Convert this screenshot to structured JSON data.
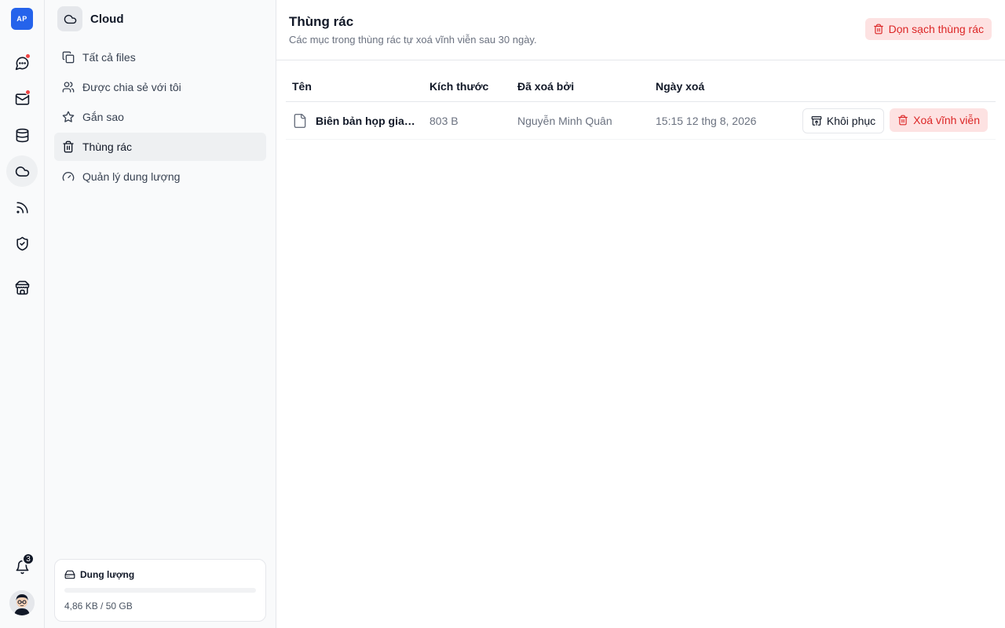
{
  "rail": {
    "logo_text": "AP",
    "notification_count": "3",
    "items": [
      {
        "name": "chat-icon",
        "badge": true
      },
      {
        "name": "mail-icon",
        "badge": true
      },
      {
        "name": "database-icon",
        "badge": false
      },
      {
        "name": "cloud-icon",
        "badge": false,
        "active": true
      },
      {
        "name": "rss-icon",
        "badge": false
      },
      {
        "name": "shield-check-icon",
        "badge": false
      },
      {
        "name": "store-icon",
        "badge": false
      }
    ]
  },
  "sidebar": {
    "title": "Cloud",
    "items": [
      {
        "label": "Tất cả files",
        "icon": "files-icon"
      },
      {
        "label": "Được chia sẻ với tôi",
        "icon": "users-icon"
      },
      {
        "label": "Gắn sao",
        "icon": "star-icon"
      },
      {
        "label": "Thùng rác",
        "icon": "trash-icon",
        "active": true
      },
      {
        "label": "Quản lý dung lượng",
        "icon": "gauge-icon"
      }
    ],
    "storage": {
      "label": "Dung lượng",
      "usage_text": "4,86 KB / 50 GB",
      "used_fraction": 1e-07
    }
  },
  "header": {
    "title": "Thùng rác",
    "subtitle": "Các mục trong thùng rác tự xoá vĩnh viễn sau 30 ngày.",
    "empty_button": "Dọn sạch thùng rác"
  },
  "table": {
    "columns": {
      "name": "Tên",
      "size": "Kích thước",
      "deleted_by": "Đã xoá bởi",
      "deleted_at": "Ngày xoá"
    },
    "rows": [
      {
        "name": "Biên bản họp giao ban",
        "size": "803 B",
        "deleted_by": "Nguyễn Minh Quân",
        "deleted_at": "15:15 12 thg 8, 2026",
        "restore_label": "Khôi phục",
        "delete_label": "Xoá vĩnh viễn"
      }
    ]
  },
  "colors": {
    "brand": "#2563eb",
    "danger": "#dc2626",
    "danger_bg": "#fde2e2",
    "badge": "#ef4444"
  }
}
